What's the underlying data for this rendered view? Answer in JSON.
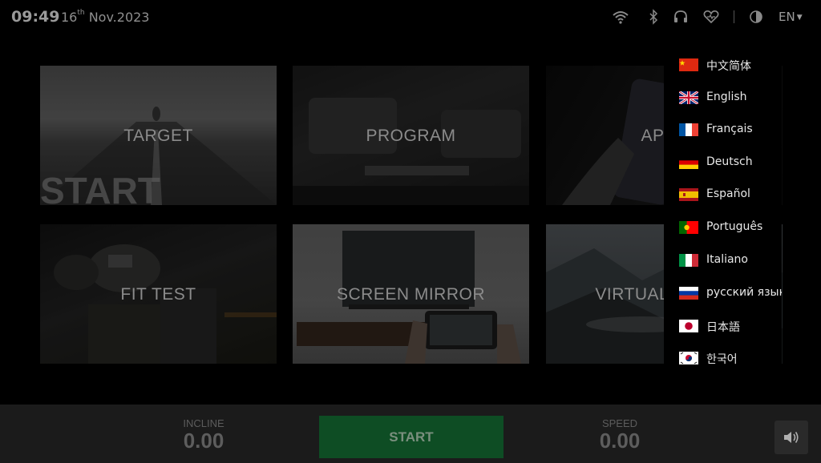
{
  "status": {
    "time": "09:49",
    "date_day": "16",
    "date_suffix": "th",
    "date_rest": "Nov.2023",
    "language_button": "EN",
    "icons": [
      "wifi-icon",
      "bluetooth-icon",
      "headphones-icon",
      "heart-rate-icon",
      "theme-contrast-icon"
    ]
  },
  "tiles": [
    {
      "id": "target",
      "label": "TARGET"
    },
    {
      "id": "program",
      "label": "PROGRAM"
    },
    {
      "id": "apps",
      "label": "APPS"
    },
    {
      "id": "fit-test",
      "label": "FIT TEST"
    },
    {
      "id": "screen-mirror",
      "label": "SCREEN MIRROR"
    },
    {
      "id": "virtual",
      "label": "VIRTUAL SCENE"
    }
  ],
  "language_menu": {
    "items": [
      {
        "label": "中文简体",
        "flag": "cn"
      },
      {
        "label": "English",
        "flag": "gb"
      },
      {
        "label": "Français",
        "flag": "fr"
      },
      {
        "label": "Deutsch",
        "flag": "de"
      },
      {
        "label": "Español",
        "flag": "es"
      },
      {
        "label": "Português",
        "flag": "pt"
      },
      {
        "label": "Italiano",
        "flag": "it"
      },
      {
        "label": "русский язык",
        "flag": "ru"
      },
      {
        "label": "日本語",
        "flag": "jp"
      },
      {
        "label": "한국어",
        "flag": "kr"
      }
    ]
  },
  "bottom": {
    "incline_label": "INCLINE",
    "incline_value": "0.00",
    "start_label": "START",
    "speed_label": "SPEED",
    "speed_value": "0.00"
  },
  "colors": {
    "start_button": "#0e4d24",
    "bottom_bar": "#1b1b1b"
  }
}
